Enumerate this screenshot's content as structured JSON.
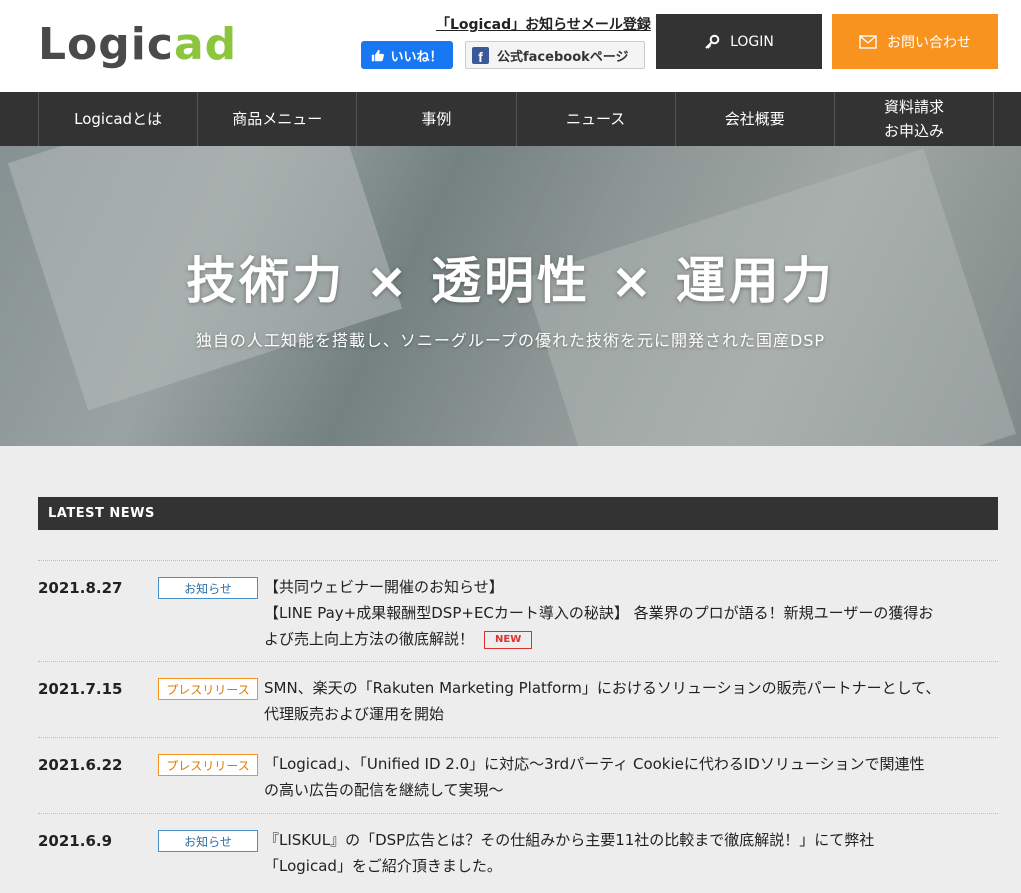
{
  "header": {
    "logo_part1": "Logic",
    "logo_part2": "ad",
    "mail_link": "「Logicad」お知らせメール登録",
    "like_label": "いいね！",
    "fb_page_label": "公式facebookページ",
    "login_label": "LOGIN",
    "contact_label": "お問い合わせ"
  },
  "nav": {
    "items": [
      {
        "label": "Logicadとは"
      },
      {
        "label": "商品メニュー"
      },
      {
        "label": "事例"
      },
      {
        "label": "ニュース"
      },
      {
        "label": "会社概要"
      },
      {
        "label_line1": "資料請求",
        "label_line2": "お申込み"
      }
    ]
  },
  "hero": {
    "title": "技術力 × 透明性 × 運用力",
    "subtitle": "独自の人工知能を搭載し、ソニーグループの優れた技術を元に開発された国産DSP"
  },
  "news": {
    "heading": "LATEST NEWS",
    "items": [
      {
        "date": "2021.8.27",
        "category": "お知らせ",
        "line1": "【共同ウェビナー開催のお知らせ】",
        "line2": "【LINE Pay+成果報酬型DSP+ECカート導入の秘訣】 各業界のプロが語る！新規ユーザーの獲得お",
        "line3": "よび売上向上方法の徹底解説！",
        "new_label": "NEW"
      },
      {
        "date": "2021.7.15",
        "category": "プレスリリース",
        "line1": "SMN、楽天の「Rakuten Marketing Platform」におけるソリューションの販売パートナーとして、",
        "line2": "代理販売および運用を開始"
      },
      {
        "date": "2021.6.22",
        "category": "プレスリリース",
        "line1": "「Logicad」、「Unified ID 2.0」に対応〜3rdパーティ Cookieに代わるIDソリューションで関連性",
        "line2": "の高い広告の配信を継続して実現〜"
      },
      {
        "date": "2021.6.9",
        "category": "お知らせ",
        "line1": "『LISKUL』の「DSP広告とは？その仕組みから主要11社の比較まで徹底解説！」にて弊社",
        "line2": "「Logicad」をご紹介頂きました。"
      }
    ]
  },
  "colors": {
    "brand_green": "#8cc63f",
    "dark": "#333333",
    "accent_orange": "#f7931e",
    "facebook_blue": "#1877f2"
  }
}
